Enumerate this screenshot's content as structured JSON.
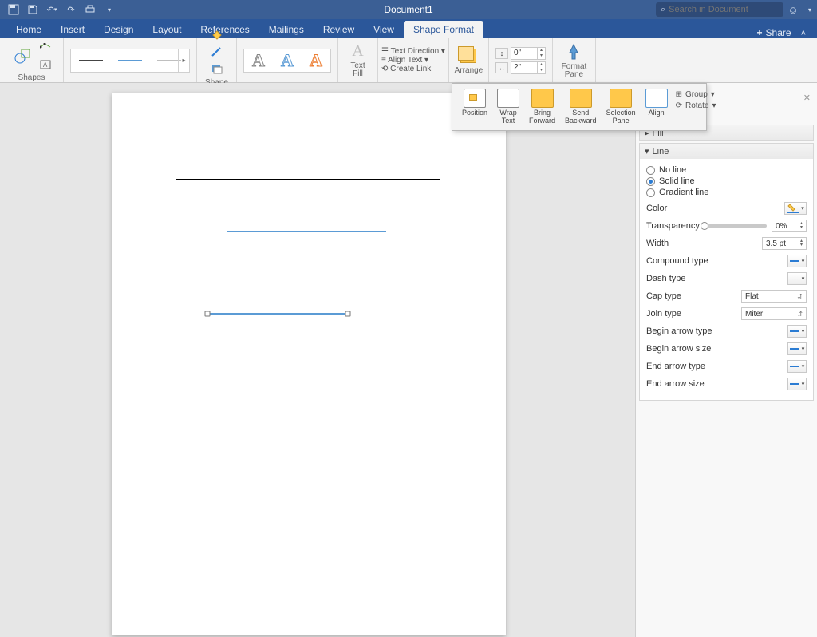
{
  "titlebar": {
    "title": "Document1",
    "search_placeholder": "Search in Document"
  },
  "tabs": {
    "items": [
      {
        "label": "Home"
      },
      {
        "label": "Insert"
      },
      {
        "label": "Design"
      },
      {
        "label": "Layout"
      },
      {
        "label": "References"
      },
      {
        "label": "Mailings"
      },
      {
        "label": "Review"
      },
      {
        "label": "View"
      },
      {
        "label": "Shape Format",
        "active": true
      }
    ],
    "share": "Share"
  },
  "ribbon": {
    "shapes": "Shapes",
    "shape_fill": "Shape\nFill",
    "text_fill": "Text Fill",
    "text_direction": "Text Direction",
    "align_text": "Align Text",
    "create_link": "Create Link",
    "arrange": "Arrange",
    "format_pane": "Format\nPane",
    "height": "0\"",
    "width": "2\""
  },
  "arrange_popup": {
    "items": [
      {
        "label": "Position"
      },
      {
        "label": "Wrap\nText"
      },
      {
        "label": "Bring\nForward"
      },
      {
        "label": "Send\nBackward"
      },
      {
        "label": "Selection\nPane"
      },
      {
        "label": "Align"
      }
    ],
    "group": "Group",
    "rotate": "Rotate"
  },
  "pane": {
    "fill": "Fill",
    "line": "Line",
    "no_line": "No line",
    "solid_line": "Solid line",
    "gradient_line": "Gradient line",
    "color": "Color",
    "transparency": "Transparency",
    "transparency_val": "0%",
    "width": "Width",
    "width_val": "3.5 pt",
    "compound": "Compound type",
    "dash": "Dash type",
    "cap": "Cap type",
    "cap_val": "Flat",
    "join": "Join type",
    "join_val": "Miter",
    "begin_arrow_type": "Begin arrow type",
    "begin_arrow_size": "Begin arrow size",
    "end_arrow_type": "End arrow type",
    "end_arrow_size": "End arrow size"
  }
}
